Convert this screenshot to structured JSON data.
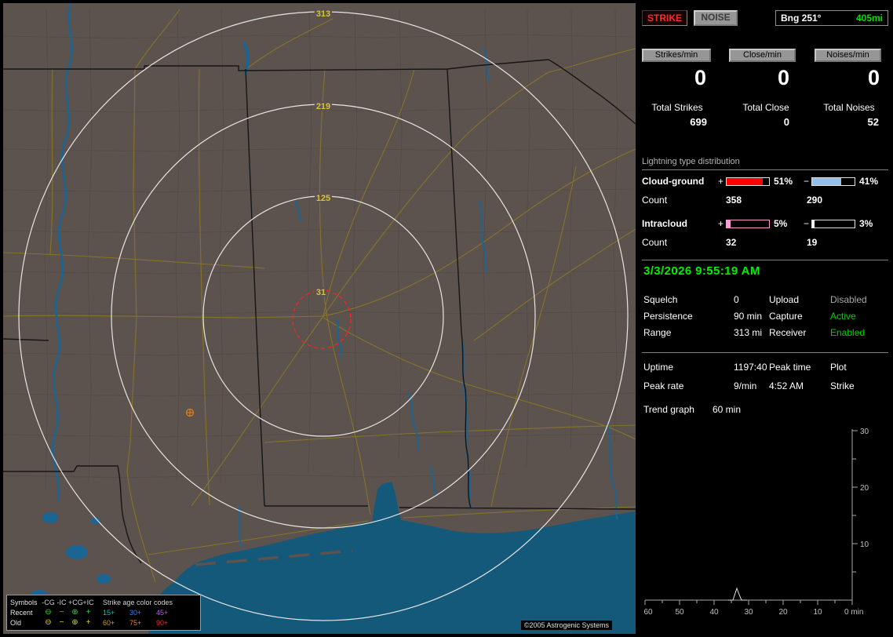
{
  "app": {
    "copyright": "©2005 Astrogenic Systems"
  },
  "map": {
    "ring_labels": {
      "r313": "313",
      "r219": "219",
      "r125": "125",
      "r31": "31"
    },
    "legend": {
      "symbols_title": "Symbols",
      "columns": [
        "-CG",
        "-IC",
        "+CG",
        "+IC"
      ],
      "age_title": "Strike age color codes",
      "recent_label": "Recent",
      "old_label": "Old",
      "recent_symbols": [
        "⊖",
        "−",
        "⊕",
        "+"
      ],
      "old_symbols": [
        "⊖",
        "−",
        "⊕",
        "+"
      ],
      "recent_ages": [
        "15+",
        "30+",
        "45+"
      ],
      "old_ages": [
        "60+",
        "75+",
        "90+"
      ]
    }
  },
  "panel": {
    "strike_button": "STRIKE",
    "noise_button": "NOISE",
    "bearing": "Bng 251°",
    "bearing_range": "405mi",
    "rates": {
      "strikes": {
        "button": "Strikes/min",
        "value": "0",
        "total_label": "Total Strikes",
        "total": "699"
      },
      "close": {
        "button": "Close/min",
        "value": "0",
        "total_label": "Total Close",
        "total": "0"
      },
      "noises": {
        "button": "Noises/min",
        "value": "0",
        "total_label": "Total Noises",
        "total": "52"
      }
    },
    "distribution": {
      "title": "Lightning type distribution",
      "cloud_ground": {
        "name": "Cloud-ground",
        "plus": "+",
        "plus_pct": "51%",
        "minus": "−",
        "minus_pct": "41%",
        "count_label": "Count",
        "plus_count": "358",
        "minus_count": "290"
      },
      "intracloud": {
        "name": "Intracloud",
        "plus": "+",
        "plus_pct": "5%",
        "minus": "−",
        "minus_pct": "3%",
        "count_label": "Count",
        "plus_count": "32",
        "minus_count": "19"
      }
    },
    "datetime": "3/3/2026 9:55:19 AM",
    "status": {
      "squelch_label": "Squelch",
      "squelch": "0",
      "persistence_label": "Persistence",
      "persistence": "90 min",
      "range_label": "Range",
      "range": "313 mi",
      "upload_label": "Upload",
      "upload": "Disabled",
      "capture_label": "Capture",
      "capture": "Active",
      "receiver_label": "Receiver",
      "receiver": "Enabled"
    },
    "stats": {
      "uptime_label": "Uptime",
      "uptime": "1197:40",
      "peak_time_label": "Peak time",
      "peak_time": "4:52 AM",
      "plot_label": "Plot",
      "plot": "Strike",
      "peak_rate_label": "Peak rate",
      "peak_rate": "9/min"
    },
    "trend": {
      "label": "Trend graph",
      "window": "60 min"
    }
  },
  "colors": {
    "accent_green": "#00e000",
    "alert_red": "#ff2a2a",
    "ring_label_yellow": "#d6c23e",
    "cg_plus_bar": "#ff0000",
    "cg_minus_bar": "#8fc1f0",
    "ic_plus_bar": "#ff9ad2",
    "ic_minus_bar": "#ffffff",
    "age_15": "#00c8c8",
    "age_30": "#3f7fff",
    "age_45": "#b05ce0",
    "age_60": "#c8a018",
    "age_75": "#ff7818",
    "age_90": "#ff2a2a",
    "recent_symbol": "#35d53a",
    "old_symbol": "#d8d332"
  },
  "chart_data": {
    "type": "line",
    "title": "Trend graph (strike rate, last 60 minutes)",
    "x_ticks": [
      "60",
      "50",
      "40",
      "30",
      "20",
      "10",
      "0 min"
    ],
    "y_ticks": [
      "30",
      "20",
      "10"
    ],
    "ylim": [
      0,
      30
    ],
    "x_range_minutes_ago": [
      60,
      0
    ],
    "legend_position": "none",
    "grid": false,
    "series": [
      {
        "name": "Strike",
        "points_min_ago_value": [
          [
            60,
            0
          ],
          [
            50,
            0
          ],
          [
            40,
            0
          ],
          [
            36,
            0
          ],
          [
            35,
            2
          ],
          [
            34,
            1
          ],
          [
            33,
            0
          ],
          [
            30,
            0
          ],
          [
            20,
            0
          ],
          [
            10,
            0
          ],
          [
            0,
            0
          ]
        ]
      }
    ]
  }
}
